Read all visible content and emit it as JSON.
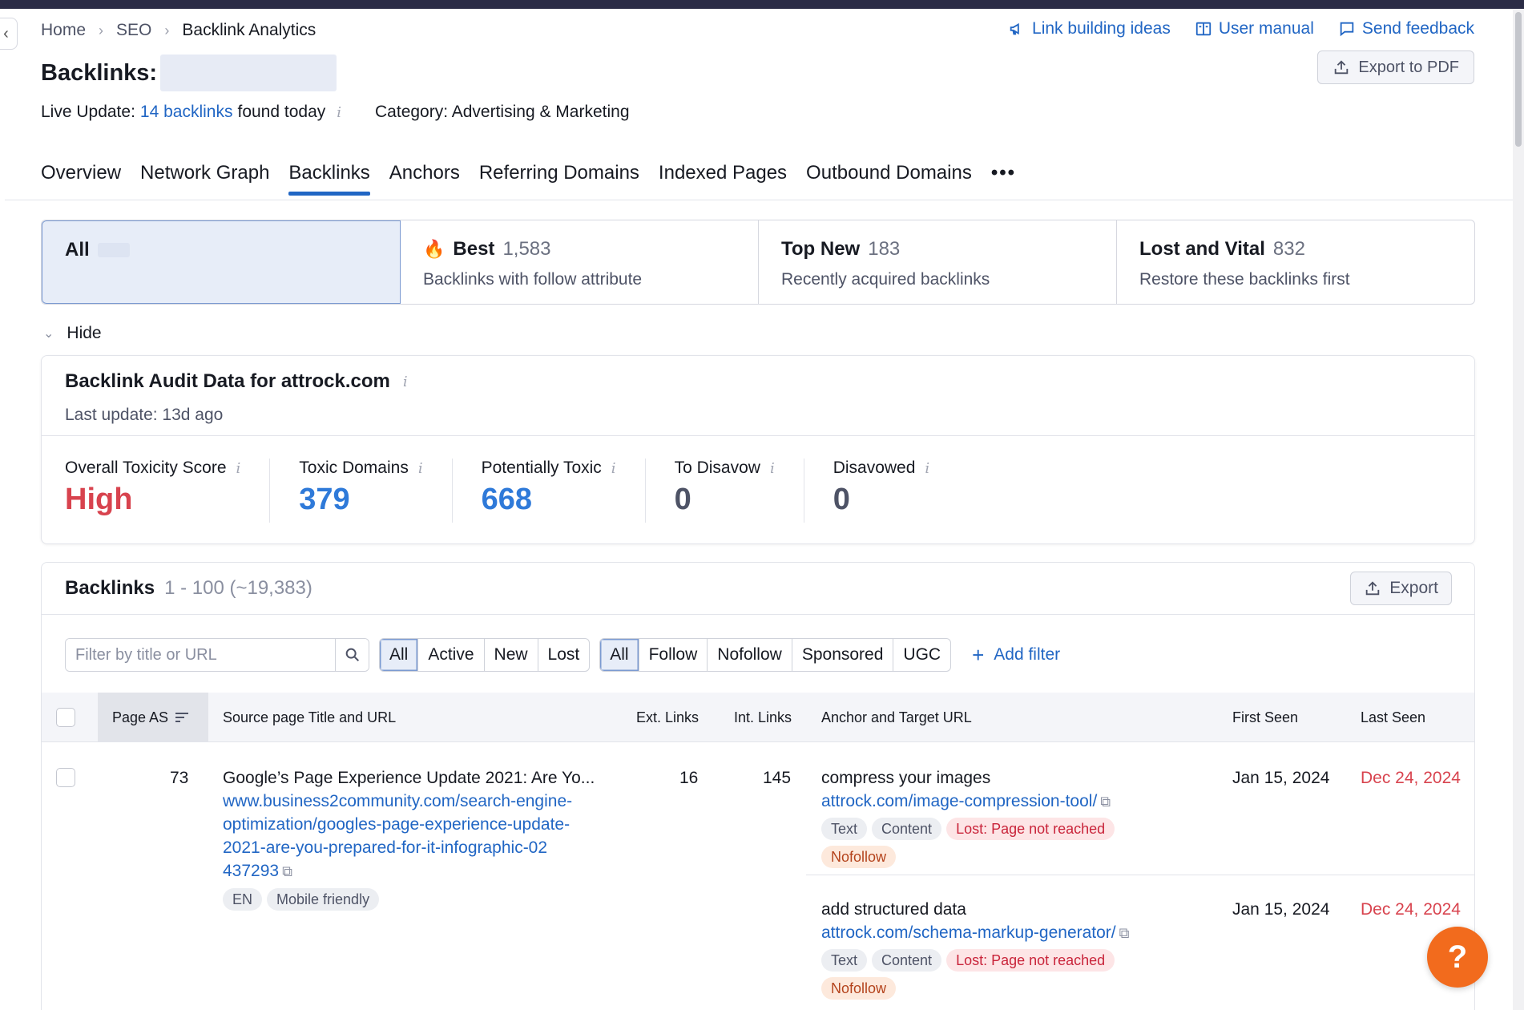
{
  "breadcrumb": [
    "Home",
    "SEO",
    "Backlink Analytics"
  ],
  "top_links": {
    "ideas": "Link building ideas",
    "manual": "User manual",
    "feedback": "Send feedback"
  },
  "export_pdf": "Export to PDF",
  "header": {
    "title": "Backlinks:"
  },
  "live": {
    "prefix": "Live Update:",
    "link": "14 backlinks",
    "suffix": "found today",
    "category": "Category: Advertising & Marketing"
  },
  "tabs": [
    "Overview",
    "Network Graph",
    "Backlinks",
    "Anchors",
    "Referring Domains",
    "Indexed Pages",
    "Outbound Domains"
  ],
  "tabs_more": "•••",
  "segments": {
    "all": {
      "label": "All"
    },
    "best": {
      "label": "Best",
      "count": "1,583",
      "desc": "Backlinks with follow attribute"
    },
    "topnew": {
      "label": "Top New",
      "count": "183",
      "desc": "Recently acquired backlinks"
    },
    "lost": {
      "label": "Lost and Vital",
      "count": "832",
      "desc": "Restore these backlinks first"
    }
  },
  "hide_label": "Hide",
  "audit": {
    "title": "Backlink Audit Data for attrock.com",
    "last_update": "Last update: 13d ago",
    "metrics": [
      {
        "label": "Overall Toxicity Score",
        "value": "High",
        "color": "#d8434e"
      },
      {
        "label": "Toxic Domains",
        "value": "379",
        "color": "#2f7ad9"
      },
      {
        "label": "Potentially Toxic",
        "value": "668",
        "color": "#2f7ad9"
      },
      {
        "label": "To Disavow",
        "value": "0",
        "color": "#4e5366"
      },
      {
        "label": "Disavowed",
        "value": "0",
        "color": "#4e5366"
      }
    ]
  },
  "backlinks": {
    "title": "Backlinks",
    "range": "1 - 100 (~19,383)",
    "export": "Export",
    "search_placeholder": "Filter by title or URL",
    "status_filters": [
      "All",
      "Active",
      "New",
      "Lost"
    ],
    "type_filters": [
      "All",
      "Follow",
      "Nofollow",
      "Sponsored",
      "UGC"
    ],
    "add_filter": "Add filter",
    "columns": [
      "Page AS",
      "Source page Title and URL",
      "Ext. Links",
      "Int. Links",
      "Anchor and Target URL",
      "First Seen",
      "Last Seen"
    ],
    "rows": [
      {
        "page_as": "73",
        "title": "Google’s Page Experience Update 2021: Are Yo...",
        "url_lines": [
          "www.business2community.com/search-engine-",
          "optimization/googles-page-experience-update-",
          "2021-are-you-prepared-for-it-infographic-02",
          "437293"
        ],
        "tags": [
          "EN",
          "Mobile friendly"
        ],
        "ext_links": "16",
        "int_links": "145",
        "anchors": [
          {
            "text": "compress your images",
            "url": "attrock.com/image-compression-tool/",
            "badges": [
              "Text",
              "Content"
            ],
            "lost": "Lost: Page not reached",
            "nofollow": "Nofollow",
            "first_seen": "Jan 15, 2024",
            "last_seen": "Dec 24, 2024"
          },
          {
            "text": "add structured data",
            "url": "attrock.com/schema-markup-generator/",
            "badges": [
              "Text",
              "Content"
            ],
            "lost": "Lost: Page not reached",
            "nofollow": "Nofollow",
            "first_seen": "Jan 15, 2024",
            "last_seen": "Dec 24, 2024"
          }
        ]
      }
    ]
  },
  "help": "?",
  "colors": {
    "accent": "#2166c4",
    "danger": "#d8434e",
    "brand_orange": "#f26b1d",
    "topbar": "#2b2c46"
  },
  "icons": [
    "megaphone-icon",
    "book-icon",
    "chat-icon",
    "export-icon",
    "flame-icon",
    "info-icon",
    "search-icon",
    "sort-icon",
    "external-link-icon",
    "chevron-down-icon",
    "plus-icon",
    "help-icon"
  ]
}
